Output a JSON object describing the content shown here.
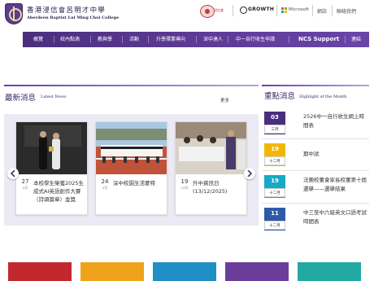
{
  "header": {
    "school_name_zh": "香港浸信會呂明才中學",
    "school_name_en": "Aberdeen Baptist Lui Ming Choi College",
    "partner_badge_text": "浸信會",
    "growth_label": "GROWTH",
    "microsoft_label": "Microsoft",
    "top_links": [
      "網誌",
      "聯絡我們"
    ]
  },
  "nav": {
    "items": [
      "概覽",
      "校內點滴",
      "教與學",
      "活動",
      "升學擇業導向",
      "深中達人",
      "中一自行收生申請",
      "NCS Support",
      "連結"
    ]
  },
  "news": {
    "title": "最新消息",
    "title_en": "Latest News",
    "more_label": "更多",
    "cards": [
      {
        "day": "27",
        "month": "5月",
        "text": "本校學生榮獲2025生成式AI英語創作大賽（詩頌篇章）金獎"
      },
      {
        "day": "24",
        "month": "3月",
        "text": "深中校園生活蒙特"
      },
      {
        "day": "19",
        "month": "12月",
        "text": "升中資訊日 (13/12/2025)"
      }
    ]
  },
  "highlight": {
    "title": "重點消息",
    "title_en": "Highlight of the Month",
    "items": [
      {
        "day": "03",
        "month": "三月",
        "text": "2526中一自行收生網上時間表",
        "color": "#4a2e7d"
      },
      {
        "day": "19",
        "month": "十二月",
        "text": "期中試",
        "color": "#f2b705"
      },
      {
        "day": "19",
        "month": "十二月",
        "text": "法團校董會家長校董第十屆選舉——選舉結果",
        "color": "#16a9c9"
      },
      {
        "day": "11",
        "month": "十二月",
        "text": "中三至中六級英文口語考試時間表",
        "color": "#2f5aa8"
      }
    ]
  },
  "tiles": {
    "colors": [
      "#c3272e",
      "#f0a21a",
      "#1f8fc6",
      "#6a3d9a",
      "#21a9a2"
    ]
  },
  "colors": {
    "accent": "#4a2e7d",
    "nav_gradient_start": "#4a2e7d",
    "nav_gradient_end": "#6a45a8",
    "panel": "#eceaf4"
  }
}
